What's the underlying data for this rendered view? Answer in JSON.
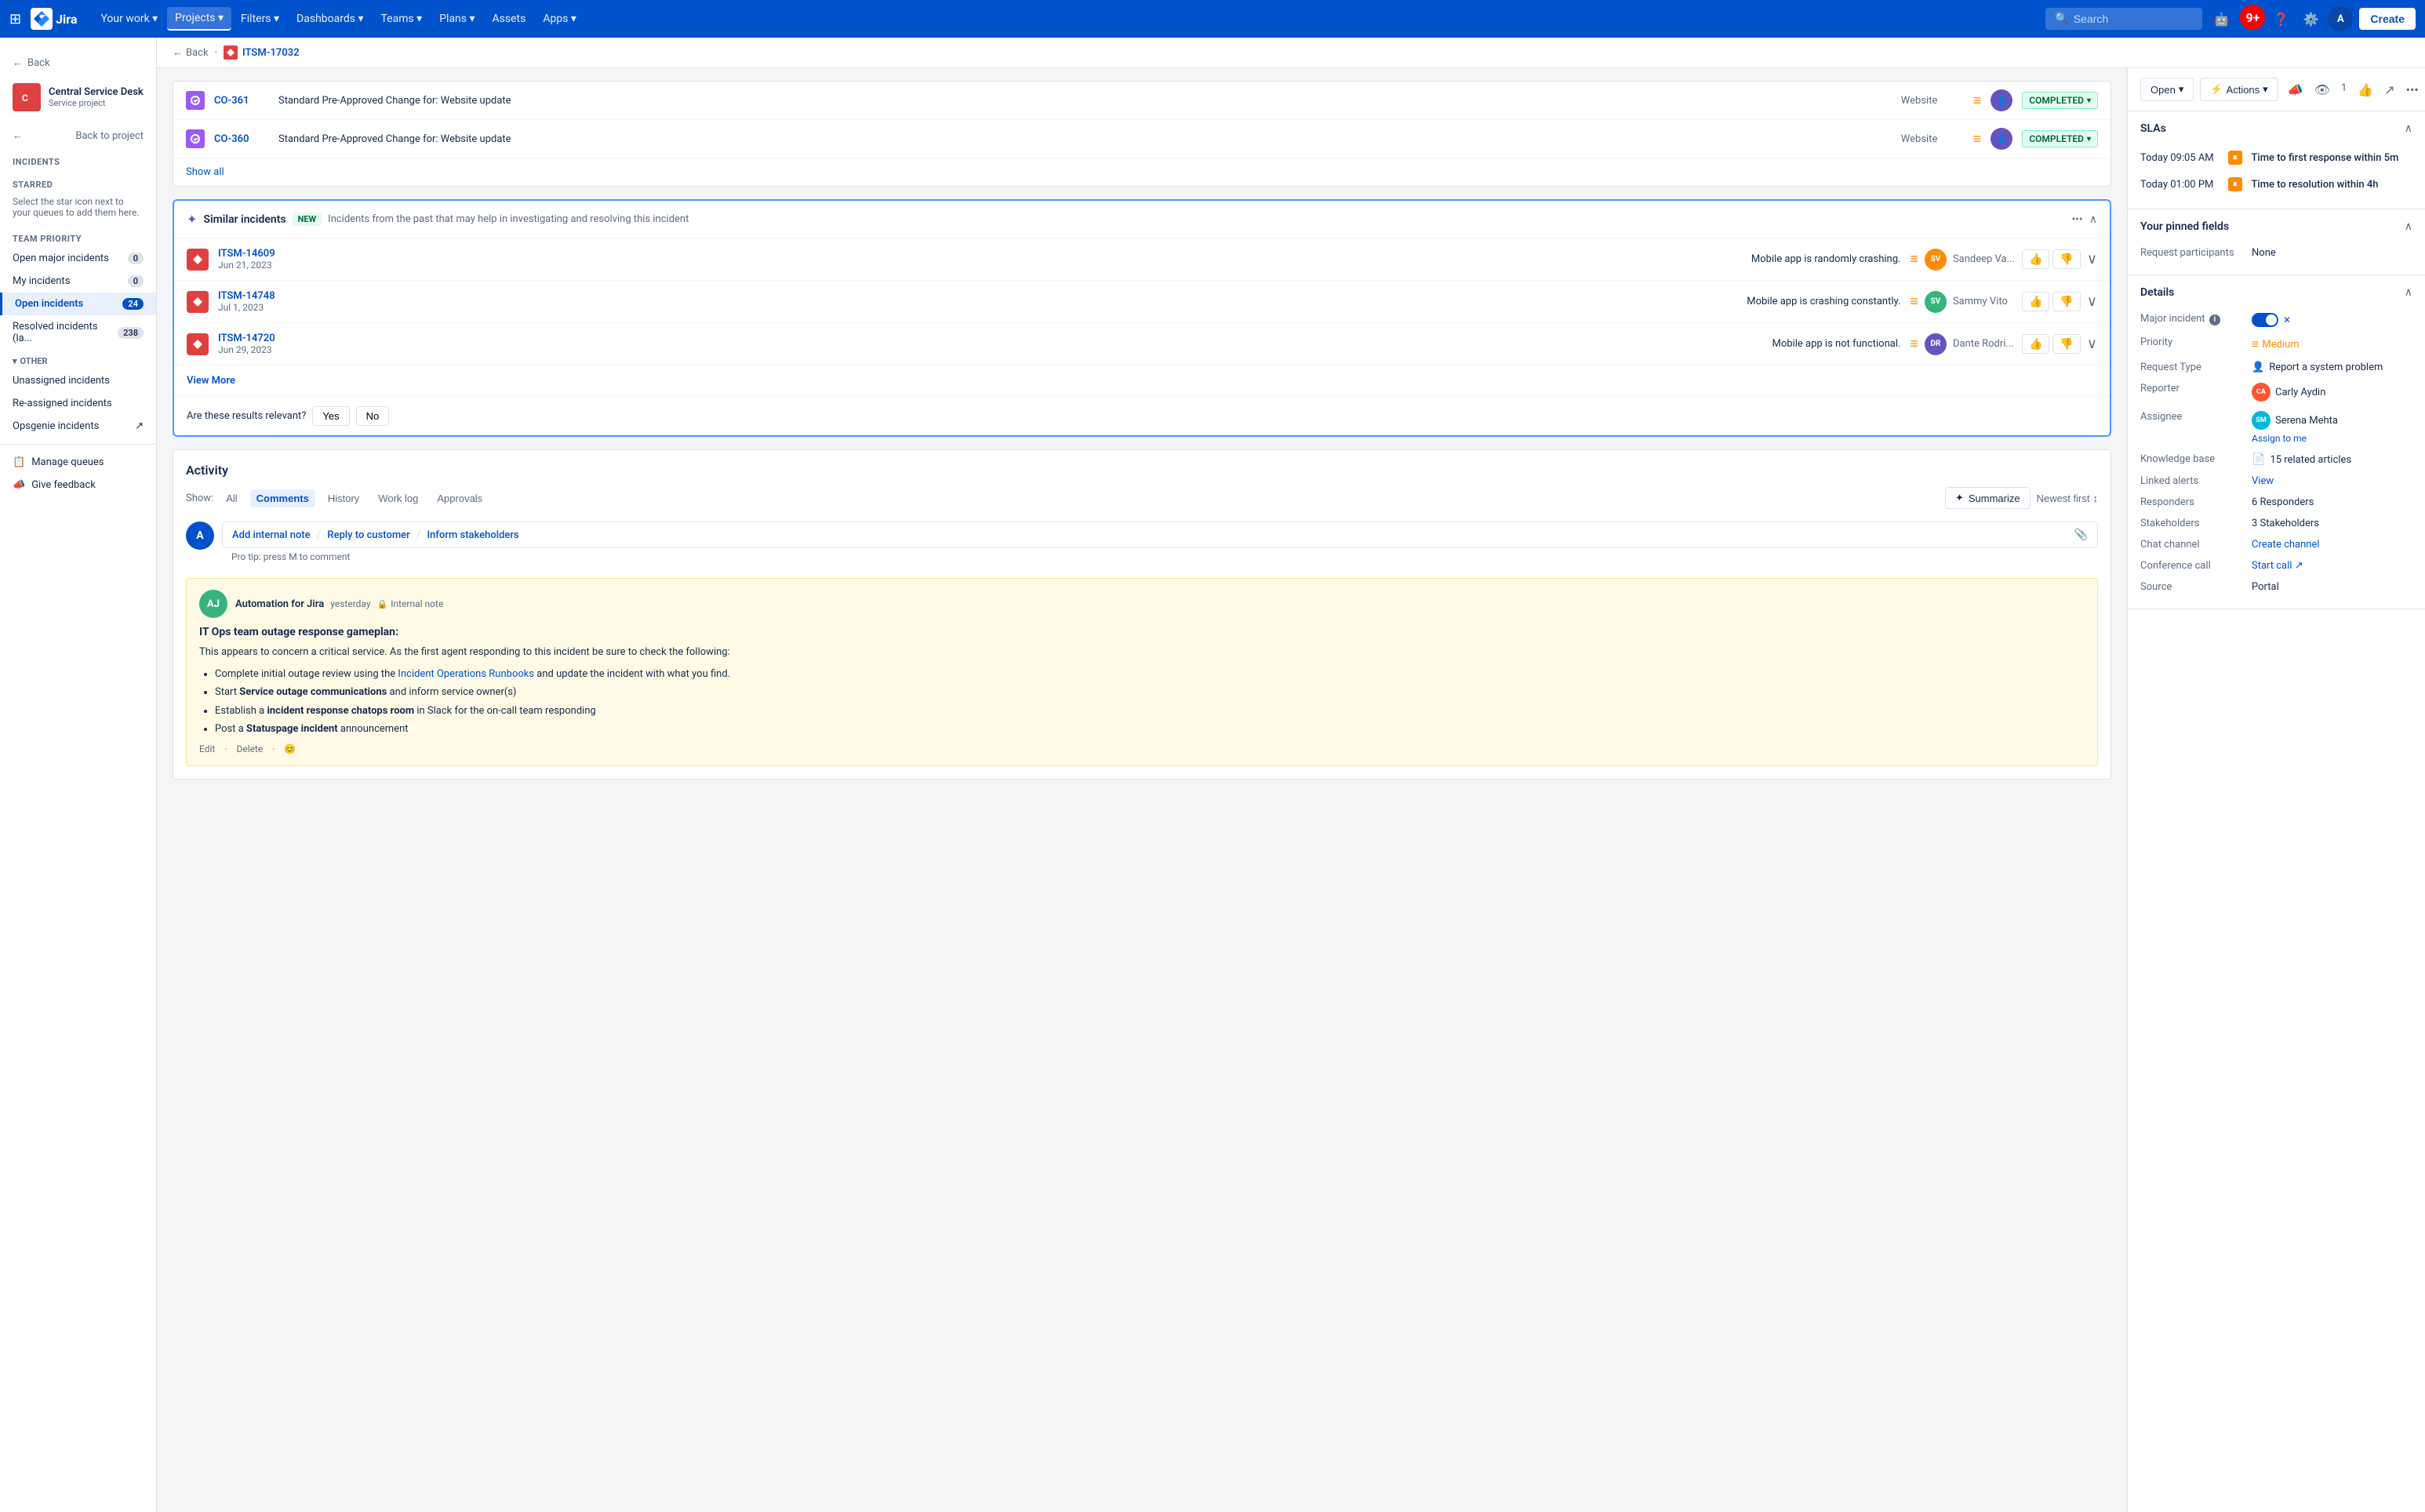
{
  "nav": {
    "grid_icon": "⊞",
    "logo_text": "Jira",
    "items": [
      {
        "label": "Your work",
        "has_arrow": true,
        "active": false
      },
      {
        "label": "Projects",
        "has_arrow": true,
        "active": true
      },
      {
        "label": "Filters",
        "has_arrow": true,
        "active": false
      },
      {
        "label": "Dashboards",
        "has_arrow": true,
        "active": false
      },
      {
        "label": "Teams",
        "has_arrow": true,
        "active": false
      },
      {
        "label": "Plans",
        "has_arrow": true,
        "active": false
      },
      {
        "label": "Assets",
        "has_arrow": false,
        "active": false
      },
      {
        "label": "Apps",
        "has_arrow": true,
        "active": false
      }
    ],
    "create_label": "Create",
    "search_placeholder": "Search",
    "notification_count": "9+",
    "user_initials": "A"
  },
  "sidebar": {
    "back_label": "Back",
    "project_name": "Central Service Desk",
    "project_type": "Service project",
    "project_initials": "C",
    "back_to_project": "Back to project",
    "section_title": "Incidents",
    "starred_label": "STARRED",
    "starred_hint": "Select the star icon next to your queues to add them here.",
    "team_priority_label": "TEAM PRIORITY",
    "items": [
      {
        "label": "Open major incidents",
        "count": "0",
        "active": false
      },
      {
        "label": "My incidents",
        "count": "0",
        "active": false
      },
      {
        "label": "Open incidents",
        "count": "24",
        "active": true
      },
      {
        "label": "Resolved incidents (la...",
        "count": "238",
        "active": false
      }
    ],
    "other_label": "OTHER",
    "other_items": [
      {
        "label": "Unassigned incidents"
      },
      {
        "label": "Re-assigned incidents"
      },
      {
        "label": "Opsgenie incidents",
        "has_external": true
      }
    ],
    "bottom_items": [
      {
        "label": "Manage queues",
        "icon": "queue"
      },
      {
        "label": "Give feedback",
        "icon": "feedback"
      }
    ]
  },
  "breadcrumb": {
    "back_label": "Back",
    "issue_key": "ITSM-17032"
  },
  "changes": {
    "rows": [
      {
        "key": "CO-361",
        "title": "Standard Pre-Approved Change for: Website update",
        "category": "Website",
        "status": "COMPLETED",
        "has_avatar": true
      },
      {
        "key": "CO-360",
        "title": "Standard Pre-Approved Change for: Website update",
        "category": "Website",
        "status": "COMPLETED",
        "has_avatar": true
      }
    ],
    "show_all_label": "Show all"
  },
  "similar_incidents": {
    "ai_icon": "✦",
    "title": "Similar incidents",
    "new_badge": "NEW",
    "description": "Incidents from the past that may help in investigating and resolving this incident",
    "rows": [
      {
        "key": "ITSM-14609",
        "date": "Jun 21, 2023",
        "title": "Mobile app is randomly crashing.",
        "assignee": "Sandeep Va...",
        "assignee_color": "#ff8b00"
      },
      {
        "key": "ITSM-14748",
        "date": "Jul 1, 2023",
        "title": "Mobile app is crashing constantly.",
        "assignee": "Sammy Vito",
        "assignee_color": "#36b37e"
      },
      {
        "key": "ITSM-14720",
        "date": "Jun 29, 2023",
        "title": "Mobile app is not functional.",
        "assignee": "Dante Rodri...",
        "assignee_color": "#6554c0"
      }
    ],
    "view_more_label": "View More",
    "relevance_question": "Are these results relevant?",
    "yes_label": "Yes",
    "no_label": "No"
  },
  "activity": {
    "title": "Activity",
    "show_label": "Show:",
    "filters": [
      "All",
      "Comments",
      "History",
      "Work log",
      "Approvals"
    ],
    "active_filter": "Comments",
    "summarize_label": "Summarize",
    "sort_label": "Newest first",
    "add_internal_note": "Add internal note",
    "reply_to_customer": "Reply to customer",
    "inform_stakeholders": "Inform stakeholders",
    "pro_tip": "Pro tip: press M to comment",
    "note": {
      "author": "Automation for Jira",
      "author_initials": "AJ",
      "time": "yesterday",
      "type": "Internal note",
      "lock": "🔒",
      "heading": "IT Ops team outage response gameplan:",
      "intro": "This appears to concern a critical service. As the first agent responding to this incident be sure to check the following:",
      "items": [
        {
          "text": "Complete initial outage review using the ",
          "link_text": "Incident Operations Runbooks",
          "link": "#",
          "suffix": " and update the incident with what you find."
        },
        {
          "text": "Start ",
          "bold": "Service outage communications",
          "suffix": " and inform service owner(s)"
        },
        {
          "text": "Establish a ",
          "bold": "incident response chatops room",
          "suffix": " in Slack for the on-call team responding"
        },
        {
          "text": "Post a ",
          "bold": "Statuspage incident",
          "suffix": " announcement"
        }
      ],
      "footer": [
        "Edit",
        "Delete",
        "😊"
      ]
    }
  },
  "right_panel": {
    "open_label": "Open",
    "actions_label": "Actions",
    "slas_title": "SLAs",
    "slas": [
      {
        "time": "Today 09:05 AM",
        "pause_icon": "⏸",
        "label": "Time to first response",
        "sublabel": "within 5m"
      },
      {
        "time": "Today 01:00 PM",
        "pause_icon": "⏸",
        "label": "Time to resolution",
        "sublabel": "within 4h"
      }
    ],
    "pinned_fields_title": "Your pinned fields",
    "pinned_fields": [
      {
        "label": "Request participants",
        "value": "None"
      }
    ],
    "details_title": "Details",
    "details": [
      {
        "label": "Major incident",
        "type": "toggle",
        "value": "on",
        "has_info": true
      },
      {
        "label": "Priority",
        "type": "priority",
        "value": "Medium"
      },
      {
        "label": "Request Type",
        "type": "text_icon",
        "value": "Report a system problem",
        "icon": "person"
      },
      {
        "label": "Reporter",
        "type": "avatar",
        "value": "Carly Aydin",
        "initials": "CA",
        "color": "#ff5630"
      },
      {
        "label": "Assignee",
        "type": "avatar_with_link",
        "value": "Serena Mehta",
        "initials": "SM",
        "color": "#00b8d9",
        "link": "Assign to me"
      },
      {
        "label": "Knowledge base",
        "type": "text_icon",
        "value": "15 related articles",
        "icon": "doc"
      },
      {
        "label": "Linked alerts",
        "type": "link",
        "value": "View"
      },
      {
        "label": "Responders",
        "type": "text",
        "value": "6 Responders"
      },
      {
        "label": "Stakeholders",
        "type": "text",
        "value": "3 Stakeholders"
      },
      {
        "label": "Chat channel",
        "type": "link",
        "value": "Create channel"
      },
      {
        "label": "Conference call",
        "type": "link_external",
        "value": "Start call"
      },
      {
        "label": "Source",
        "type": "text",
        "value": "Portal"
      }
    ]
  }
}
